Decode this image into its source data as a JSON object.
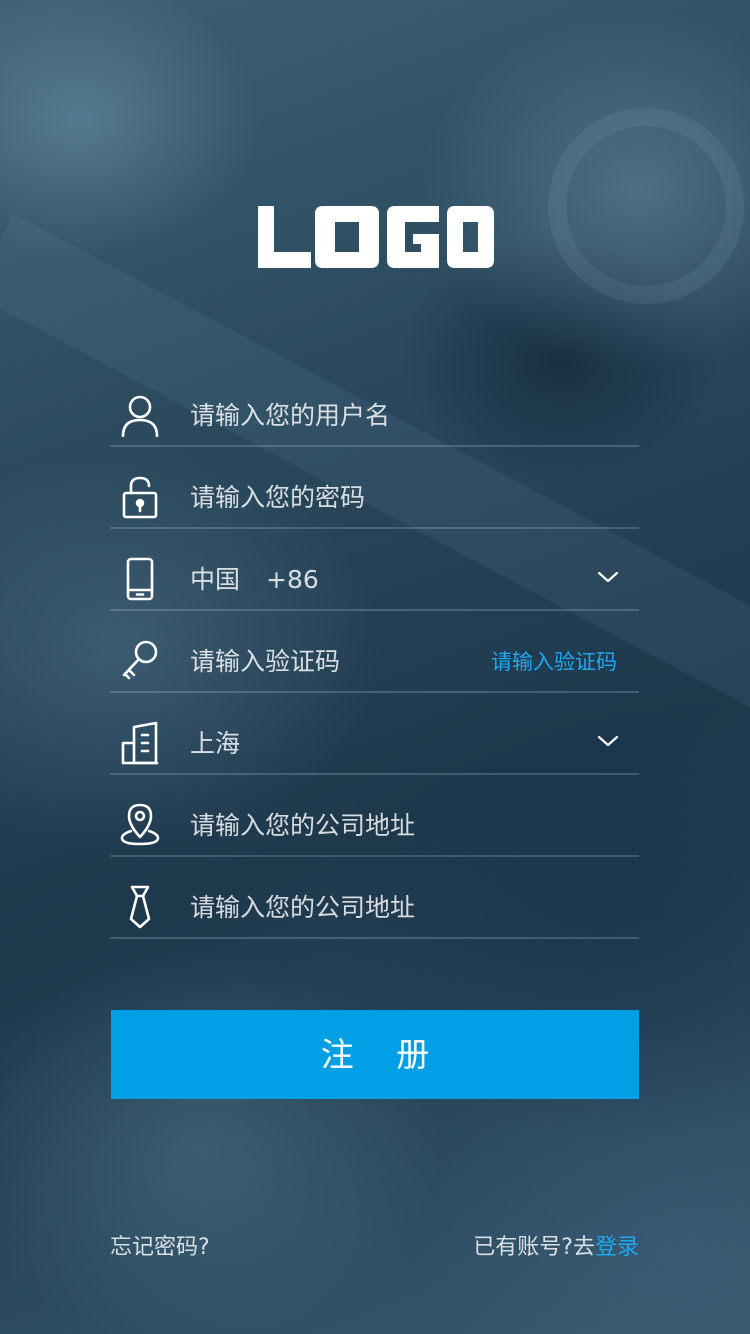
{
  "logo": {
    "text": "LOGO"
  },
  "form": {
    "username": {
      "placeholder": "请输入您的用户名",
      "icon": "user-icon"
    },
    "password": {
      "placeholder": "请输入您的密码",
      "icon": "lock-icon"
    },
    "phone": {
      "country": "中国",
      "code": "+86",
      "icon": "phone-icon",
      "dropdown_icon": "chevron-down-icon"
    },
    "verify": {
      "placeholder": "请输入验证码",
      "link_label": "请输入验证码",
      "icon": "key-icon"
    },
    "city": {
      "value": "上海",
      "icon": "building-icon",
      "dropdown_icon": "chevron-down-icon"
    },
    "address": {
      "placeholder": "请输入您的公司地址",
      "icon": "location-pin-icon"
    },
    "position": {
      "placeholder": "请输入您的公司地址",
      "icon": "tie-icon"
    }
  },
  "register_button": {
    "label": "注 册"
  },
  "footer": {
    "forgot_label": "忘记密码?",
    "have_account_label": "已有账号?去",
    "login_label": "登录"
  },
  "colors": {
    "accent": "#009fe6",
    "link": "#1ea8f0"
  }
}
